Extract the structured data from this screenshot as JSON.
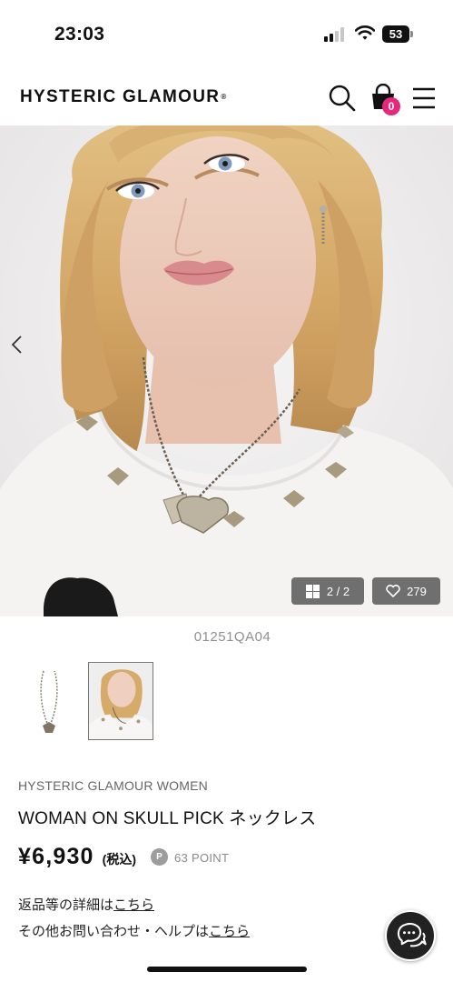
{
  "status_bar": {
    "time": "23:03",
    "battery": "53"
  },
  "header": {
    "logo": "HYSTERIC GLAMOUR",
    "logo_mark": "®",
    "cart_count": "0",
    "cart_badge_color": "#e5287c"
  },
  "gallery": {
    "counter": "2 / 2",
    "favorites": "279",
    "current_index": 2,
    "total": 2
  },
  "product": {
    "sku": "01251QA04",
    "brand": "HYSTERIC GLAMOUR WOMEN",
    "name": "WOMAN ON SKULL PICK ネックレス",
    "price": "¥6,930",
    "tax_label": "(税込)",
    "point_icon_label": "P",
    "points": "63 POINT"
  },
  "info_links": {
    "returns_prefix": "返品等の詳細は",
    "returns_link": "こちら",
    "help_prefix": "その他お問い合わせ・ヘルプは",
    "help_link": "こちら"
  },
  "icons": {
    "search": "search-icon",
    "cart": "shopping-bag-icon",
    "menu": "hamburger-menu-icon",
    "prev": "chevron-left-icon",
    "gallery": "grid-icon",
    "favorite": "heart-icon",
    "chat": "chat-bubble-icon"
  }
}
